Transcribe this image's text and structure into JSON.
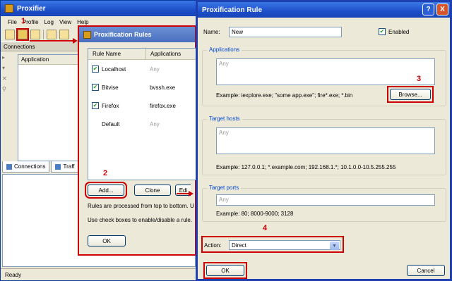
{
  "main_window": {
    "title": "Proxifier",
    "menu": [
      "File",
      "Profile",
      "Log",
      "View",
      "Help"
    ],
    "connections_label": "Connections",
    "application_header": "Application",
    "tabs": [
      "Connections",
      "Traff"
    ],
    "status": "Ready"
  },
  "rules_dialog": {
    "title": "Proxification Rules",
    "columns": [
      "Rule Name",
      "Applications"
    ],
    "rows": [
      {
        "name": "Localhost",
        "app": "Any",
        "checked": true
      },
      {
        "name": "Bitvise",
        "app": "bvssh.exe",
        "checked": true
      },
      {
        "name": "Firefox",
        "app": "firefox.exe",
        "checked": true
      },
      {
        "name": "Default",
        "app": "Any",
        "checked": false
      }
    ],
    "add_button": "Add...",
    "clone_button": "Clone",
    "edit_button": "Edi",
    "note1": "Rules are processed from top to bottom. U",
    "note2": "Use check boxes to enable/disable a rule.",
    "ok_button": "OK"
  },
  "rule_dialog": {
    "title": "Proxification Rule",
    "help_glyph": "?",
    "close_glyph": "X",
    "name_label": "Name:",
    "name_value": "New",
    "enabled_label": "Enabled",
    "enabled_checked": true,
    "applications_group": "Applications",
    "applications_value": "Any",
    "applications_example": "Example: iexplore.exe; \"some app.exe\"; fire*.exe; *.bin",
    "browse_button": "Browse...",
    "target_hosts_group": "Target hosts",
    "target_hosts_value": "Any",
    "target_hosts_example": "Example: 127.0.0.1; *.example.com; 192.168.1.*; 10.1.0.0-10.5.255.255",
    "target_ports_group": "Target ports",
    "target_ports_value": "Any",
    "target_ports_example": "Example: 80; 8000-9000; 3128",
    "action_label": "Action:",
    "action_value": "Direct",
    "ok_button": "OK",
    "cancel_button": "Cancel"
  },
  "steps": [
    "1",
    "2",
    "3",
    "4"
  ],
  "colors": {
    "annotation_red": "#cc0000",
    "titlebar_blue": "#1d4fc9"
  }
}
